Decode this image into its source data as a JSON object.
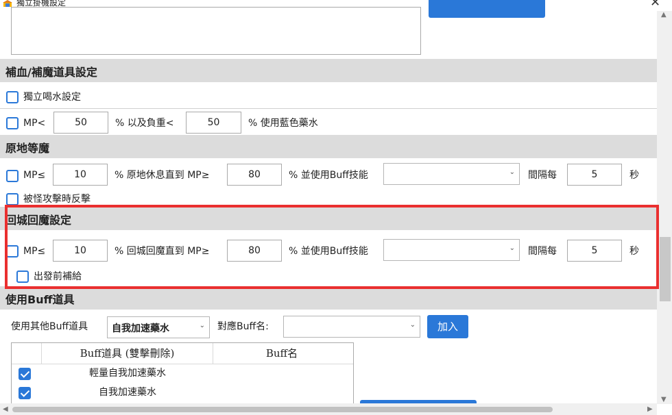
{
  "window": {
    "title": "獨立掛機設定",
    "close_glyph": "✕"
  },
  "sections": {
    "potion": {
      "header": "補血/補魔道具設定"
    },
    "idle": {
      "header": "原地等魔"
    },
    "return": {
      "header": "回城回魔設定"
    },
    "buff": {
      "header": "使用Buff道具"
    }
  },
  "potion": {
    "independent_drink": {
      "label": "獨立喝水設定",
      "checked": false
    },
    "mp_row": {
      "checked": false,
      "prefix": "MP<",
      "mp_value": "50",
      "middle": "% 以及負重<",
      "weight_value": "50",
      "suffix": "% 使用藍色藥水"
    }
  },
  "idle": {
    "checked": false,
    "prefix": "MP≤",
    "mp_value": "10",
    "middle": "% 原地休息直到 MP≥",
    "target_value": "80",
    "buff_label": "% 並使用Buff技能",
    "buff_select": "",
    "interval_label": "間隔每",
    "interval_value": "5",
    "unit": "秒",
    "counter": {
      "label": "被怪攻擊時反擊",
      "checked": false
    }
  },
  "return_town": {
    "checked": false,
    "prefix": "MP≤",
    "mp_value": "10",
    "middle": "% 回城回魔直到 MP≥",
    "target_value": "80",
    "buff_label": "% 並使用Buff技能",
    "buff_select": "",
    "interval_label": "間隔每",
    "interval_value": "5",
    "unit": "秒",
    "resupply": {
      "label": "出發前補給",
      "checked": false
    }
  },
  "buff_items": {
    "other_label": "使用其他Buff道具",
    "other_select": "自我加速藥水",
    "buff_name_label": "對應Buff名:",
    "buff_name_select": "",
    "add_button": "加入",
    "table": {
      "columns": [
        "Buff道具 (雙擊刪除)",
        "Buff名"
      ],
      "rows": [
        {
          "checked": true,
          "item": "輕量自我加速藥水",
          "buff": ""
        },
        {
          "checked": true,
          "item": "自我加速藥水",
          "buff": ""
        }
      ]
    }
  },
  "colors": {
    "accent": "#2a78d8",
    "highlight": "#ea2f2f",
    "section_bg": "#dcdcdc"
  },
  "icons": {
    "checkbox": "checkbox-icon",
    "dropdown": "chevron-down-icon",
    "close": "close-icon"
  }
}
